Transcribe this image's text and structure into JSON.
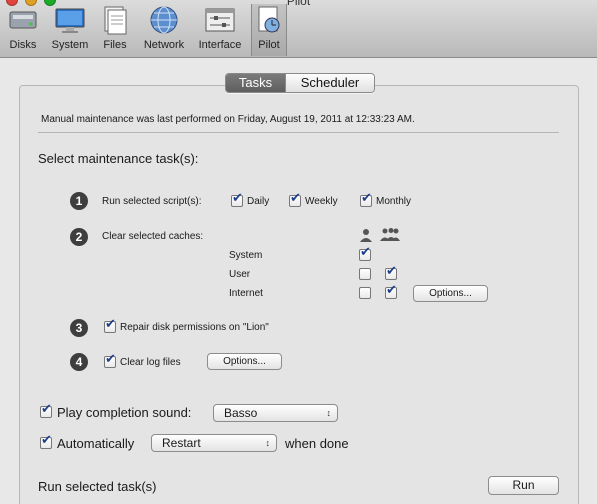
{
  "window": {
    "title": "Pilot"
  },
  "toolbar": {
    "items": [
      {
        "label": "Disks",
        "icon": "disks-icon"
      },
      {
        "label": "System",
        "icon": "system-icon"
      },
      {
        "label": "Files",
        "icon": "files-icon"
      },
      {
        "label": "Network",
        "icon": "network-icon"
      },
      {
        "label": "Interface",
        "icon": "interface-icon"
      },
      {
        "label": "Pilot",
        "icon": "pilot-icon",
        "selected": true
      }
    ]
  },
  "tabs": {
    "active": "Tasks",
    "inactive": "Scheduler"
  },
  "status": "Manual maintenance was last performed on Friday, August 19, 2011 at 12:33:23 AM.",
  "section_heading": "Select maintenance task(s):",
  "task1": {
    "number": "1",
    "label": "Run selected script(s):",
    "daily": {
      "label": "Daily",
      "checked": true
    },
    "weekly": {
      "label": "Weekly",
      "checked": true
    },
    "monthly": {
      "label": "Monthly",
      "checked": true
    }
  },
  "task2": {
    "number": "2",
    "label": "Clear selected caches:",
    "user_icon": "single-user-icon",
    "users_icon": "multiple-users-icon",
    "rows": [
      {
        "label": "System",
        "user": null,
        "all": true
      },
      {
        "label": "User",
        "user": false,
        "all": true
      },
      {
        "label": "Internet",
        "user": false,
        "all": true
      }
    ],
    "options_label": "Options..."
  },
  "task3": {
    "number": "3",
    "label": "Repair disk permissions on \"Lion\"",
    "checked": true
  },
  "task4": {
    "number": "4",
    "label": "Clear log files",
    "checked": true,
    "options_label": "Options..."
  },
  "sound": {
    "label": "Play completion sound:",
    "checked": true,
    "value": "Basso"
  },
  "auto": {
    "label": "Automatically",
    "checked": true,
    "value": "Restart",
    "suffix": "when done"
  },
  "footer": {
    "label": "Run selected task(s)",
    "run_label": "Run"
  },
  "colors": {
    "check": "#1d3f8a",
    "tab_active": "#6b6b6b"
  }
}
